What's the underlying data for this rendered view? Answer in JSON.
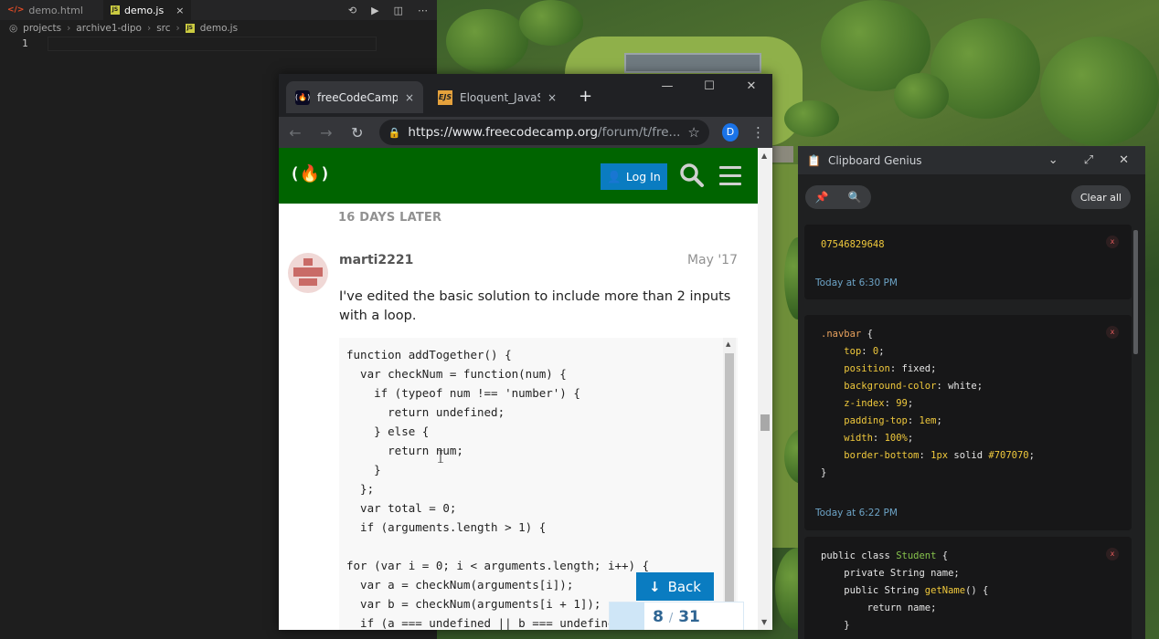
{
  "vscode": {
    "tabs": [
      {
        "label": "demo.html",
        "icon": "html-icon"
      },
      {
        "label": "demo.js",
        "icon": "js-icon",
        "close": "×"
      }
    ],
    "breadcrumb": [
      "projects",
      "archive1-dipo",
      "src",
      "demo.js"
    ],
    "line_number": "1"
  },
  "chrome": {
    "tabs": [
      {
        "label": "freeCodeCamp Forum",
        "icon": "freecodecamp-favicon"
      },
      {
        "label": "Eloquent_JavaScript",
        "icon": "ejs-favicon",
        "icon_text": "EJS"
      }
    ],
    "tab_close": "×",
    "new_tab": "+",
    "url_host": "https://www.freecodecamp.org",
    "url_path": "/forum/t/fre...",
    "profile_initial": "D"
  },
  "forum": {
    "logo": "(🔥)",
    "login_label": "Log In",
    "time_gap": "16 DAYS LATER",
    "post": {
      "username": "marti2221",
      "date": "May '17",
      "text": "I've edited the basic solution to include more than 2 inputs with a loop.",
      "code": "function addTogether() {\n  var checkNum = function(num) {\n    if (typeof num !== 'number') {\n      return undefined;\n    } else {\n      return num;\n    }\n  };\n  var total = 0;\n  if (arguments.length > 1) {\n\nfor (var i = 0; i < arguments.length; i++) {\n  var a = checkNum(arguments[i]);\n  var b = checkNum(arguments[i + 1]);\n  if (a === undefined || b === undefined) {"
    },
    "back_label": "Back",
    "progress": {
      "current": "8",
      "total": "31",
      "fraction": 0.258
    }
  },
  "clipboard": {
    "title": "Clipboard Genius",
    "clear_label": "Clear all",
    "remove_label": "x",
    "items": [
      {
        "text": "07546829648",
        "time": "Today at 6:30 PM"
      },
      {
        "time": "Today at 6:22 PM"
      },
      {}
    ]
  },
  "colors": {
    "fcc_green": "#006400",
    "fcc_blue": "#0a7cc1",
    "clip_time": "#6da4c7",
    "clip_accent": "#f0c93c"
  }
}
